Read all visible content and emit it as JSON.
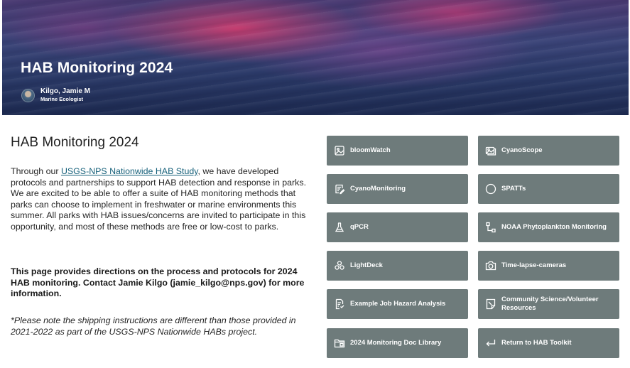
{
  "hero": {
    "title": "HAB Monitoring 2024",
    "author_name": "Kilgo, Jamie M",
    "author_role": "Marine Ecologist"
  },
  "content": {
    "title": "HAB Monitoring 2024",
    "intro_before_link": "Through our ",
    "intro_link": "USGS-NPS Nationwide HAB Study",
    "intro_after_link": ", we have developed protocols and partnerships to support HAB detection and response in parks. We are excited to be able to offer a suite of HAB monitoring methods that parks can choose to implement in freshwater or marine environments this summer. All parks with HAB issues/concerns are invited to participate in this opportunity, and most of these methods are free or low-cost to parks.",
    "directions": "This page provides directions on the process and protocols for 2024 HAB monitoring. Contact Jamie Kilgo (jamie_kilgo@nps.gov) for more information.",
    "note": "*Please note the shipping instructions are different than those provided in 2021-2022 as part of the USGS-NPS Nationwide HABs project."
  },
  "buttons": {
    "bloomwatch": {
      "label": "bloomWatch",
      "icon": "image-icon"
    },
    "cyanoscope": {
      "label": "CyanoScope",
      "icon": "images-icon"
    },
    "cyanomonitoring": {
      "label": "CyanoMonitoring",
      "icon": "form-edit-icon"
    },
    "spatts": {
      "label": "SPATTs",
      "icon": "circle-icon"
    },
    "qpcr": {
      "label": "qPCR",
      "icon": "beaker-icon"
    },
    "noaa": {
      "label": "NOAA Phytoplankton Monitoring",
      "icon": "flow-icon"
    },
    "lightdeck": {
      "label": "LightDeck",
      "icon": "molecule-icon"
    },
    "timelapse": {
      "label": "Time-lapse-cameras",
      "icon": "camera-icon"
    },
    "jha": {
      "label": "Example Job Hazard Analysis",
      "icon": "document-icon"
    },
    "community": {
      "label": "Community Science/Volunteer Resources",
      "icon": "note-icon"
    },
    "doclibrary": {
      "label": "2024 Monitoring Doc Library",
      "icon": "folder-icon"
    },
    "return": {
      "label": "Return to HAB Toolkit",
      "icon": "return-arrow-icon"
    }
  },
  "colors": {
    "button_bg": "#6e7b7b",
    "link": "#16607a"
  }
}
